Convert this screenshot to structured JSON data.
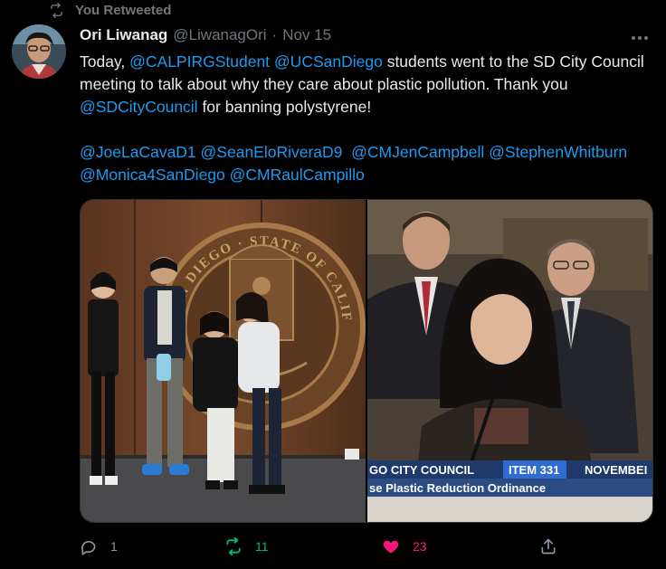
{
  "retweet": {
    "label": "You Retweeted"
  },
  "author": {
    "name": "Ori Liwanag",
    "handle": "@LiwanagOri",
    "separator": "·",
    "date": "Nov 15"
  },
  "tweet": {
    "line1_prefix": "Today, ",
    "m_calpirg": "@CALPIRGStudent",
    "m_ucsd": "@UCSanDiego",
    "line1_rest": " students went to the SD City Council meeting to talk about why they care about plastic pollution. Thank you ",
    "m_council": "@SDCityCouncil",
    "line1_end": " for banning polystyrene!",
    "m_lacava": "@JoeLaCavaD1",
    "m_elo": "@SeanEloRiveraD9",
    "m_campbell": "@CMJenCampbell",
    "m_whitburn": "@StephenWhitburn",
    "m_monica": "@Monica4SanDiego",
    "m_campillo": "@CMRaulCampillo"
  },
  "media": {
    "seal_text": "SAN DIEGO · STATE OF CALIFORNIA",
    "lower_third": {
      "channel": "GO CITY COUNCIL",
      "item": "ITEM 331",
      "month": "NOVEMBEI",
      "caption": "se Plastic Reduction Ordinance"
    }
  },
  "actions": {
    "replies": "1",
    "retweets": "11",
    "likes": "23"
  },
  "colors": {
    "background": "#000000",
    "link": "#1d9bf0",
    "muted": "#71767b",
    "retweet": "#00ba7c",
    "like": "#f91880"
  },
  "icons": {
    "retweet_bar": "retweet-icon",
    "more": "more-icon",
    "reply": "reply-icon",
    "retweet": "retweet-icon",
    "like": "heart-icon",
    "share": "share-icon"
  }
}
